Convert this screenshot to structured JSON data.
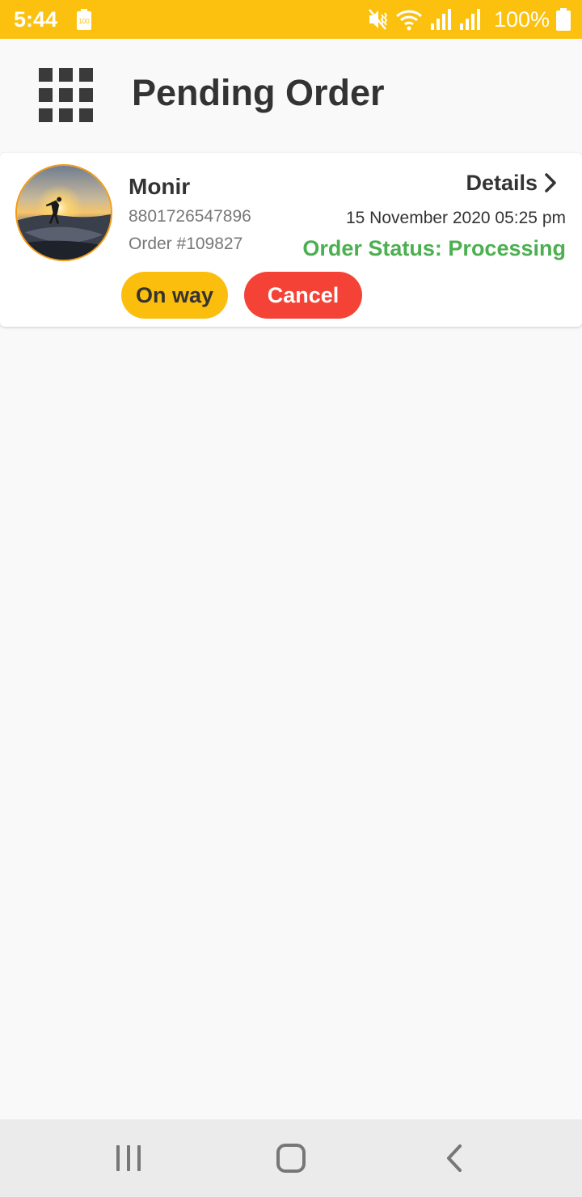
{
  "status_bar": {
    "time": "5:44",
    "battery_small_label": "100",
    "battery_percent": "100%",
    "icons": [
      "battery-saver-icon",
      "mute-vibrate-icon",
      "wifi-icon",
      "signal-icon",
      "signal-icon",
      "battery-icon"
    ]
  },
  "header": {
    "title": "Pending Order",
    "menu_icon": "grid-menu-icon"
  },
  "order": {
    "customer_name": "Monir",
    "phone": "8801726547896",
    "order_number": "Order #109827",
    "details_label": "Details",
    "date": "15 November 2020 05:25 pm",
    "status": "Order Status: Processing",
    "on_way_label": "On way",
    "cancel_label": "Cancel",
    "colors": {
      "accent": "#fcc10e",
      "status": "#4caf50",
      "cancel": "#f44336"
    }
  },
  "nav_bar": {
    "icons": [
      "recent-apps-icon",
      "home-icon",
      "back-icon"
    ]
  }
}
